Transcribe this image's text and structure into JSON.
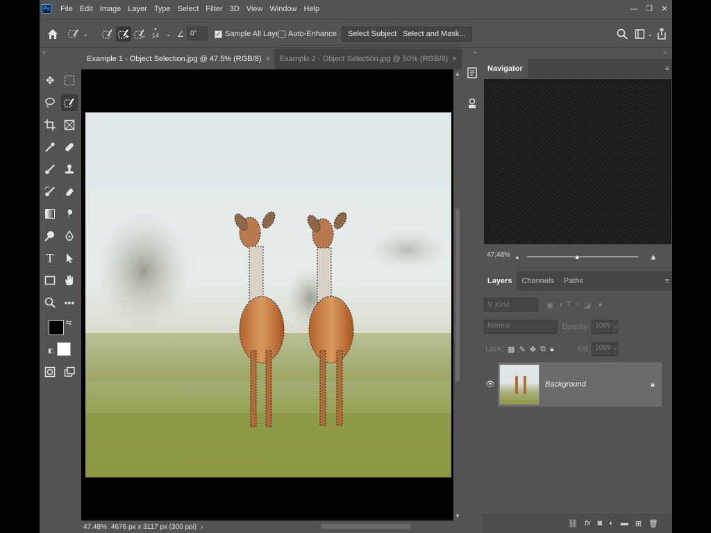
{
  "app": {
    "logo": "Ps",
    "menu": [
      "File",
      "Edit",
      "Image",
      "Layer",
      "Type",
      "Select",
      "Filter",
      "3D",
      "View",
      "Window",
      "Help"
    ],
    "window_controls": {
      "minimize": "—",
      "restore": "❐",
      "close": "✕"
    }
  },
  "options_bar": {
    "brush_size": "14",
    "angle": "0°",
    "sample_all_layers": {
      "label": "Sample All Layers",
      "checked": true
    },
    "auto_enhance": {
      "label": "Auto-Enhance",
      "checked": false
    },
    "select_subject": "Select Subject",
    "select_and_mask": "Select and Mask..."
  },
  "documents": {
    "tabs": [
      {
        "label": "Example 1 - Object Selection.jpg @ 47.5% (RGB/8)",
        "active": true
      },
      {
        "label": "Example 2 - Object Selection.jpg @ 50% (RGB/8)",
        "active": false
      }
    ],
    "close_glyph": "×",
    "status": {
      "zoom": "47.48%",
      "dimensions": "4676 px x 3117 px (300 ppi)",
      "arrow": "›"
    }
  },
  "navigator": {
    "title": "Navigator",
    "zoom": "47.48%"
  },
  "layers_panel": {
    "tabs": [
      "Layers",
      "Channels",
      "Paths"
    ],
    "filter_placeholder": "Kind",
    "blend_mode": "Normal",
    "opacity_label": "Opacity:",
    "opacity_value": "100%",
    "lock_label": "Lock:",
    "fill_label": "Fill:",
    "fill_value": "100%",
    "layers": [
      {
        "name": "Background",
        "visible": true,
        "locked": true
      }
    ]
  },
  "colors": {
    "ui_bg": "#535353",
    "panel_dark": "#454545",
    "selected_layer": "#6b6b6b",
    "foreground_color": "#000000",
    "background_color": "#ffffff",
    "navigator_bg": "#1b1b1b"
  },
  "icons": {
    "tools": [
      "move-icon",
      "marquee-icon",
      "lasso-icon",
      "object-selection-icon",
      "crop-icon",
      "frame-icon",
      "eyedropper-icon",
      "healing-brush-icon",
      "brush-icon",
      "stamp-icon",
      "history-brush-icon",
      "eraser-icon",
      "gradient-icon",
      "smudge-icon",
      "dodge-icon",
      "pen-icon",
      "type-icon",
      "path-selection-icon",
      "rectangle-icon",
      "hand-icon",
      "zoom-icon",
      "more-icon"
    ],
    "layer_footer": [
      "link-icon",
      "fx-icon",
      "mask-icon",
      "adjustment-icon",
      "group-icon",
      "new-layer-icon",
      "trash-icon"
    ]
  }
}
